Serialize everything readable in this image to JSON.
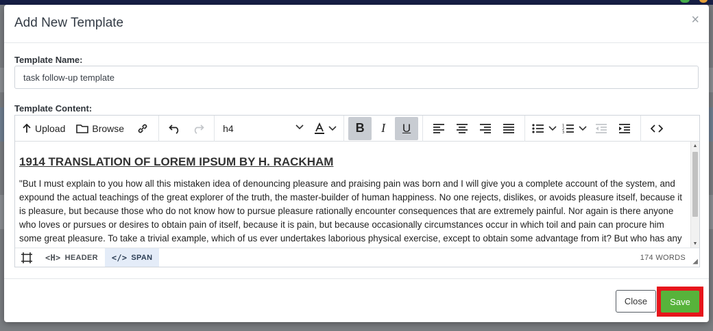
{
  "modal": {
    "title": "Add New Template",
    "close_symbol": "×"
  },
  "form": {
    "name_label": "Template Name:",
    "name_value": "task follow-up template",
    "content_label": "Template Content:"
  },
  "toolbar": {
    "upload_label": "Upload",
    "browse_label": "Browse",
    "format_value": "h4"
  },
  "editor": {
    "heading": "1914 TRANSLATION OF LOREM IPSUM BY H. RACKHAM",
    "body": "\"But I must explain to you how all this mistaken idea of denouncing pleasure and praising pain was born and I will give you a complete account of the system, and expound the actual teachings of the great explorer of the truth, the master-builder of human happiness. No one rejects, dislikes, or avoids pleasure itself, because it is pleasure, but because those who do not know how to pursue pleasure rationally encounter consequences that are extremely painful. Nor again is there anyone who loves or pursues or desires to obtain pain of itself, because it is pain, but because occasionally circumstances occur in which toil and pain can procure him some great pleasure. To take a trivial example, which of us ever undertakes laborious physical exercise, except to obtain some advantage from it? But who has any right to find fault with a man who chooses to enjoy a pleasure that has no annoying consequences, or one who avoids a pain that produces no resultant pleasure?\""
  },
  "statusbar": {
    "header_label": "HEADER",
    "span_label": "SPAN",
    "word_count": "174 WORDS"
  },
  "footer": {
    "close_label": "Close",
    "save_label": "Save"
  },
  "colors": {
    "save_button": "#57b33b",
    "save_highlight": "#e6161b",
    "topbar": "#171f46"
  }
}
